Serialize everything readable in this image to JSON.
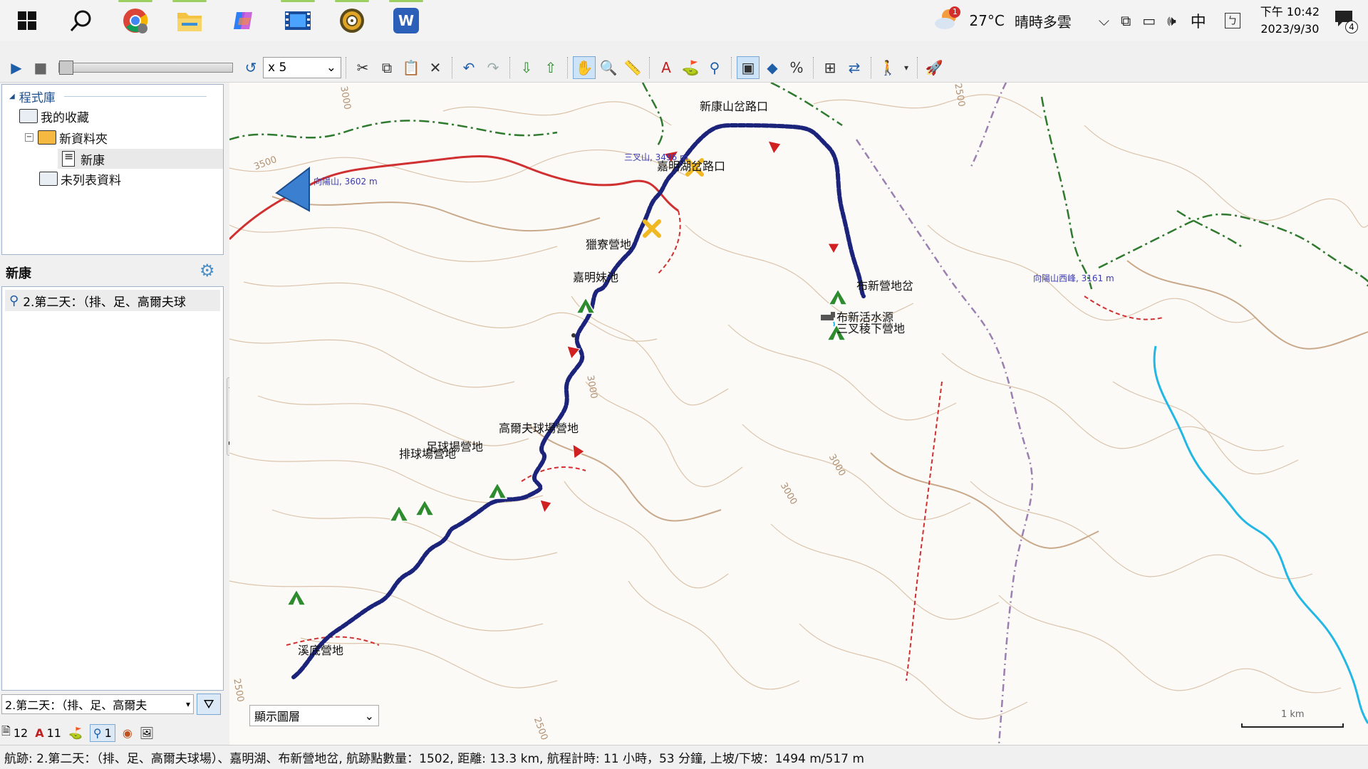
{
  "taskbar": {
    "apps": [
      {
        "name": "windows-start",
        "icon": "windows-logo-icon"
      },
      {
        "name": "search",
        "icon": "search-icon"
      },
      {
        "name": "chrome",
        "icon": "chrome-icon"
      },
      {
        "name": "file-explorer",
        "icon": "folder-icon"
      },
      {
        "name": "copilot",
        "icon": "copilot-icon"
      },
      {
        "name": "video-editor",
        "icon": "film-icon"
      },
      {
        "name": "basecamp",
        "icon": "compass-icon"
      },
      {
        "name": "word",
        "icon": "word-icon",
        "label": "W"
      }
    ],
    "weather": {
      "badge": "1",
      "temp": "27°C",
      "desc": "晴時多雲"
    },
    "ime": "中",
    "time": "下午 10:42",
    "date": "2023/9/30",
    "notification_count": "4"
  },
  "toolbar": {
    "speed_value": "x 5"
  },
  "library": {
    "header": "程式庫",
    "items": [
      {
        "label": "我的收藏"
      },
      {
        "label": "新資料夾"
      },
      {
        "label": "新康"
      },
      {
        "label": "未列表資料"
      }
    ]
  },
  "panel": {
    "title": "新康",
    "list_item": "2.第二天：（排、足、高爾夫球",
    "filter_value": "2.第二天：（排、足、高爾夫",
    "tab_counts": {
      "waypoints": "12",
      "routes": "11",
      "tracks": "1"
    }
  },
  "map": {
    "layer_combo": "顯示圖層",
    "scale_label": "1 km",
    "waypoints": [
      {
        "id": "xinkang-trailhead",
        "label": "新康山岔路口",
        "kind": "junction"
      },
      {
        "id": "jiaming-trailhead",
        "label": "嘉明湖岔路口",
        "kind": "junction"
      },
      {
        "id": "hunter-camp",
        "label": "獵寮營地",
        "kind": "camp"
      },
      {
        "id": "jiaming-sister",
        "label": "嘉明妹池",
        "kind": "lake"
      },
      {
        "id": "golf-camp",
        "label": "高爾夫球場營地",
        "kind": "camp"
      },
      {
        "id": "football-camp",
        "label": "足球場營地",
        "kind": "camp"
      },
      {
        "id": "volleyball-camp",
        "label": "排球場營地",
        "kind": "camp"
      },
      {
        "id": "creek-camp",
        "label": "溪底營地",
        "kind": "camp"
      },
      {
        "id": "buxin-junction",
        "label": "布新營地岔",
        "kind": "camp"
      },
      {
        "id": "buxin-water",
        "label": "布新活水源",
        "kind": "water"
      },
      {
        "id": "sancha-camp",
        "label": "三叉稜下營地",
        "kind": "camp"
      }
    ],
    "peaks": [
      {
        "label": "向陽山, 3602 m"
      },
      {
        "label": "三叉山, 3496 m"
      },
      {
        "label": "向陽山西峰, 3161 m"
      }
    ],
    "contour_labels": [
      "3500",
      "3000",
      "3000",
      "2500",
      "2500",
      "3000",
      "3000",
      "2500"
    ]
  },
  "status": {
    "text": "航跡: 2.第二天：（排、足、高爾夫球場）、嘉明湖、布新營地岔, 航跡點數量：1502, 距離: 13.3 km, 航程計時: 11 小時，53 分鐘, 上坡/下坡：1494 m/517 m"
  },
  "colors": {
    "track": "#1b237a",
    "trail_red": "#d03030",
    "trail_green": "#2f7a2f",
    "trail_purple": "#9a7fb0",
    "contour": "#d4b79a",
    "river": "#22b7e5",
    "junction": "#f0b823",
    "camp": "#2e8b2e"
  }
}
